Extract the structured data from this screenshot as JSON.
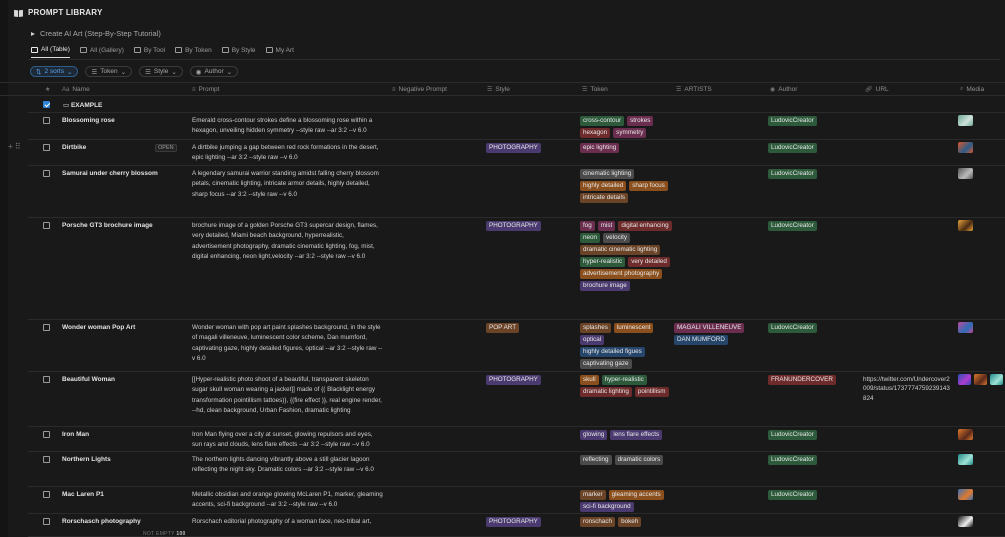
{
  "title": "PROMPT LIBRARY",
  "toggle_label": "Create AI Art (Step-By-Step Tutorial)",
  "tabs": [
    "All (Table)",
    "All (Gallery)",
    "By Tool",
    "By Token",
    "By Style",
    "My Art"
  ],
  "filters": {
    "sorts": "2 sorts",
    "token": "Token",
    "style": "Style",
    "author": "Author"
  },
  "columns": {
    "name": "Name",
    "prompt": "Prompt",
    "negative": "Negative Prompt",
    "style": "Style",
    "token": "Token",
    "artists": "ARTISTS",
    "author": "Author",
    "url": "URL",
    "media": "Media"
  },
  "open_label": "OPEN",
  "footer": {
    "label": "NOT EMPTY",
    "count": "100"
  },
  "colors": {
    "gray": "#4b4b4b",
    "brown": "#6b4326",
    "orange": "#8a4f1c",
    "yellow": "#6e5a22",
    "green": "#2c5a3b",
    "blue": "#26456b",
    "purple": "#4b3a70",
    "pink": "#6b2e4f",
    "red": "#6e2b2b"
  },
  "rows": [
    {
      "name": "EXAMPLE",
      "checked": true,
      "header_row": true,
      "prompt": "",
      "style": [],
      "tokens": [],
      "artists": [],
      "author": [],
      "url": "",
      "media": []
    },
    {
      "name": "Blossoming rose",
      "prompt": "Emerald cross-contour strokes define a blossoming rose within a hexagon, unveiling hidden symmetry --style raw --ar 3:2 --v 6.0",
      "style": [],
      "tokens": [
        {
          "t": "cross-contour",
          "c": "green"
        },
        {
          "t": "strokes",
          "c": "pink"
        },
        {
          "t": "hexagon",
          "c": "red"
        },
        {
          "t": "symmetry",
          "c": "pink"
        }
      ],
      "artists": [],
      "author": [
        {
          "t": "LudovicCreator",
          "c": "green"
        }
      ],
      "url": "",
      "media": [
        "rose-thumbnail"
      ]
    },
    {
      "name": "Dirtbike",
      "open": true,
      "prompt": "A dirtbike jumping a gap between red rock formations in the desert, epic lighting --ar 3:2 --style raw --v 6.0",
      "style": [
        {
          "t": "PHOTOGRAPHY",
          "c": "purple"
        }
      ],
      "tokens": [
        {
          "t": "epic lighting",
          "c": "pink"
        }
      ],
      "artists": [],
      "author": [
        {
          "t": "LudovicCreator",
          "c": "green"
        }
      ],
      "url": "",
      "media": [
        "dirtbike-thumbnail"
      ]
    },
    {
      "name": "Samurai under cherry blossom",
      "prompt": "A legendary samurai warrior standing amidst falling cherry blossom petals, cinematic lighting, intricate armor details, highly detailed, sharp focus --ar 3:2 --style raw --v 6.0",
      "style": [],
      "tokens": [
        {
          "t": "cinematic lighting",
          "c": "gray"
        },
        {
          "t": "highly detailed",
          "c": "orange"
        },
        {
          "t": "sharp focus",
          "c": "orange"
        },
        {
          "t": "intricate details",
          "c": "brown"
        }
      ],
      "artists": [],
      "author": [
        {
          "t": "LudovicCreator",
          "c": "green"
        }
      ],
      "url": "",
      "media": [
        "samurai-thumbnail"
      ]
    },
    {
      "name": "Porsche GT3 brochure image",
      "prompt": "brochure image of a golden Porsche GT3 supercar design, flames, very detailed, Miami beach background, hyperrealistic, advertisement photography, dramatic cinematic lighting, fog, mist, digital enhancing, neon light,velocity --ar 3:2 --style raw --v 6.0",
      "style": [
        {
          "t": "PHOTOGRAPHY",
          "c": "purple"
        }
      ],
      "tokens": [
        {
          "t": "fog",
          "c": "pink"
        },
        {
          "t": "mist",
          "c": "pink"
        },
        {
          "t": "digital enhancing",
          "c": "red"
        },
        {
          "t": "neon",
          "c": "green"
        },
        {
          "t": "velocity",
          "c": "gray"
        },
        {
          "t": "dramatic cinematic lighting",
          "c": "brown"
        },
        {
          "t": "hyper-realistic",
          "c": "green"
        },
        {
          "t": "very detailed",
          "c": "red"
        },
        {
          "t": "advertisement photography",
          "c": "orange"
        },
        {
          "t": "brochure image",
          "c": "purple"
        }
      ],
      "artists": [],
      "author": [
        {
          "t": "LudovicCreator",
          "c": "green"
        }
      ],
      "url": "",
      "media": [
        "porsche-thumbnail"
      ]
    },
    {
      "name": "Wonder woman Pop Art",
      "prompt": "Wonder woman with pop art paint splashes background, in the style of magali villeneuve, luminescent color scheme, Dan mumford, captivating gaze, highly detailed figures, optical --ar 3:2 --style raw --v 6.0",
      "style": [
        {
          "t": "POP ART",
          "c": "brown"
        }
      ],
      "tokens": [
        {
          "t": "splashes",
          "c": "brown"
        },
        {
          "t": "luminescent",
          "c": "orange"
        },
        {
          "t": "optical",
          "c": "purple"
        },
        {
          "t": "highly detailed figues",
          "c": "blue"
        },
        {
          "t": "captivating gaze",
          "c": "gray"
        }
      ],
      "artists": [
        {
          "t": "MAGALI VILLENEUVE",
          "c": "pink"
        },
        {
          "t": "DAN MUMFORD",
          "c": "blue"
        }
      ],
      "author": [
        {
          "t": "LudovicCreator",
          "c": "green"
        }
      ],
      "url": "",
      "media": [
        "wonder-woman-thumbnail"
      ]
    },
    {
      "name": "Beautiful Woman",
      "prompt": "[[Hyper-realistic photo shoot of a beautiful, transparent skeleton sugar skull woman wearing a jacket]] made of {( Blacklight energy transformation pointillism tattoes)}, {(fire effect )}, real engine render, --hd, clean background, Urban Fashion, dramatic lighting",
      "style": [
        {
          "t": "PHOTOGRAPHY",
          "c": "purple"
        }
      ],
      "tokens": [
        {
          "t": "skull",
          "c": "orange"
        },
        {
          "t": "hyper-realistic",
          "c": "green"
        },
        {
          "t": "dramatic lighting",
          "c": "red"
        },
        {
          "t": "pointillism",
          "c": "red"
        }
      ],
      "artists": [],
      "author": [
        {
          "t": "FRANUNDERCOVER",
          "c": "red"
        }
      ],
      "url": "https://twitter.com/Undercover2009/status/1737774759239143824",
      "media": [
        "skull-thumbnail-1",
        "skull-thumbnail-2",
        "skull-thumbnail-3"
      ]
    },
    {
      "name": "Iron Man",
      "prompt": "Iron Man flying over a city at sunset, glowing repulsors and eyes, sun rays and clouds, lens flare effects --ar 3:2 --style raw --v 6.0",
      "style": [],
      "tokens": [
        {
          "t": "glowing",
          "c": "purple"
        },
        {
          "t": "lens flare effects",
          "c": "purple"
        }
      ],
      "artists": [],
      "author": [
        {
          "t": "LudovicCreator",
          "c": "green"
        }
      ],
      "url": "",
      "media": [
        "iron-man-thumbnail"
      ]
    },
    {
      "name": "Northern Lights",
      "prompt": "The northern lights dancing vibrantly above a still glacier lagoon reflecting the night sky. Dramatic colors --ar 3:2 --style raw --v 6.0",
      "style": [],
      "tokens": [
        {
          "t": "reflecting",
          "c": "gray"
        },
        {
          "t": "dramatic colors",
          "c": "gray"
        }
      ],
      "artists": [],
      "author": [
        {
          "t": "LudovicCreator",
          "c": "green"
        }
      ],
      "url": "",
      "media": [
        "northern-lights-thumbnail"
      ]
    },
    {
      "name": "Mac Laren P1",
      "prompt": "Metallic obsidian and orange glowing McLaren P1, marker, gleaming accents, sci-fi background --ar 3:2 --style raw --v 6.0",
      "style": [],
      "tokens": [
        {
          "t": "marker",
          "c": "brown"
        },
        {
          "t": "gleaming accents",
          "c": "orange"
        },
        {
          "t": "sci-fi background",
          "c": "purple"
        }
      ],
      "artists": [],
      "author": [
        {
          "t": "LudovicCreator",
          "c": "green"
        }
      ],
      "url": "",
      "media": [
        "mclaren-thumbnail"
      ]
    },
    {
      "name": "Rorschasch photography",
      "prompt": "Rorschach editorial photography of a woman face, neo-tribal art,",
      "style": [
        {
          "t": "PHOTOGRAPHY",
          "c": "purple"
        }
      ],
      "tokens": [
        {
          "t": "ronschach",
          "c": "brown"
        },
        {
          "t": "bokeh",
          "c": "brown"
        }
      ],
      "artists": [],
      "author": [],
      "url": "",
      "media": [
        "rorschach-thumbnail"
      ]
    }
  ]
}
